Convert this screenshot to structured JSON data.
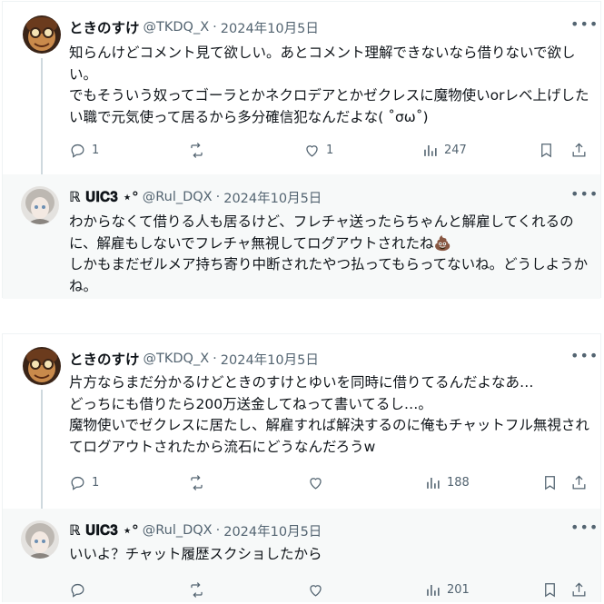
{
  "threads": [
    {
      "tweet": {
        "display_name": "ときのすけ",
        "handle": "@TKDQ_X",
        "separator": "·",
        "date": "2024年10月5日",
        "text": "知らんけどコメント見て欲しい。あとコメント理解できないなら借りないで欲しい。\nでもそういう奴ってゴーラとかネクロデアとかゼクレスに魔物使いorレベ上げしたい職で元気使って居るから多分確信犯なんだよな( ˚σω˚)",
        "replies": "1",
        "retweets": "",
        "likes": "1",
        "views": "247"
      },
      "reply": {
        "display_name": "ℝ 𝐔𝐈𝐂𝟑 ⋆°",
        "handle": "@Rul_DQX",
        "separator": "·",
        "date": "2024年10月5日",
        "text": "わからなくて借りる人も居るけど、フレチャ送ったらちゃんと解雇してくれるのに、解雇もしないでフレチャ無視してログアウトされたね💩\nしかもまだゼルメア持ち寄り中断されたやつ払ってもらってないね。どうしようかね。"
      }
    },
    {
      "tweet": {
        "display_name": "ときのすけ",
        "handle": "@TKDQ_X",
        "separator": "·",
        "date": "2024年10月5日",
        "text": "片方ならまだ分かるけどときのすけとゆいを同時に借りてるんだよなあ…\nどっちにも借りたら200万送金してねって書いてるし…。\n魔物使いでゼクレスに居たし、解雇すれば解決するのに俺もチャットフル無視されてログアウトされたから流石にどうなんだろうw",
        "replies": "1",
        "retweets": "",
        "likes": "",
        "views": "188"
      },
      "reply": {
        "display_name": "ℝ 𝐔𝐈𝐂𝟑 ⋆°",
        "handle": "@Rul_DQX",
        "separator": "·",
        "date": "2024年10月5日",
        "text": "いいよ？チャット履歴スクショしたから",
        "views": "201"
      }
    }
  ],
  "icons": {
    "reply": "reply-icon",
    "retweet": "retweet-icon",
    "like": "heart-icon",
    "views": "views-icon",
    "bookmark": "bookmark-icon",
    "share": "share-icon",
    "more": "more-icon"
  },
  "colors": {
    "text": "#0f1419",
    "secondary": "#536471",
    "border": "#eff3f4",
    "thread_line": "#cfd9de",
    "reply_background": "#f7f9f9"
  }
}
